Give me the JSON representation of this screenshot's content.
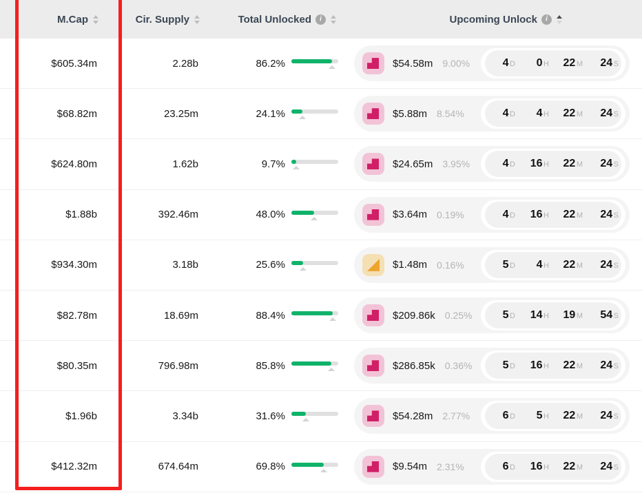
{
  "header": {
    "columns": [
      {
        "label": "M.Cap",
        "has_info": false,
        "sort": "none"
      },
      {
        "label": "Cir. Supply",
        "has_info": false,
        "sort": "none"
      },
      {
        "label": "Total Unlocked",
        "has_info": true,
        "sort": "none"
      },
      {
        "label": "Upcoming Unlock",
        "has_info": true,
        "sort": "asc"
      }
    ]
  },
  "rows": [
    {
      "mcap": "$605.34m",
      "supply": "2.28b",
      "unlocked_pct_label": "86.2%",
      "unlocked_pct": 86.2,
      "unlock_amount": "$54.58m",
      "unlock_pct": "9.00%",
      "icon": "token-step-pink-icon",
      "icon_variant": "pink",
      "cd_d": "4",
      "cd_h": "0",
      "cd_m": "22",
      "cd_s": "24"
    },
    {
      "mcap": "$68.82m",
      "supply": "23.25m",
      "unlocked_pct_label": "24.1%",
      "unlocked_pct": 24.1,
      "unlock_amount": "$5.88m",
      "unlock_pct": "8.54%",
      "icon": "token-step-pink-icon",
      "icon_variant": "pink",
      "cd_d": "4",
      "cd_h": "4",
      "cd_m": "22",
      "cd_s": "24"
    },
    {
      "mcap": "$624.80m",
      "supply": "1.62b",
      "unlocked_pct_label": "9.7%",
      "unlocked_pct": 9.7,
      "unlock_amount": "$24.65m",
      "unlock_pct": "3.95%",
      "icon": "token-step-pink-icon",
      "icon_variant": "pink",
      "cd_d": "4",
      "cd_h": "16",
      "cd_m": "22",
      "cd_s": "24"
    },
    {
      "mcap": "$1.88b",
      "supply": "392.46m",
      "unlocked_pct_label": "48.0%",
      "unlocked_pct": 48.0,
      "unlock_amount": "$3.64m",
      "unlock_pct": "0.19%",
      "icon": "token-step-pink-icon",
      "icon_variant": "pink",
      "cd_d": "4",
      "cd_h": "16",
      "cd_m": "22",
      "cd_s": "24"
    },
    {
      "mcap": "$934.30m",
      "supply": "3.18b",
      "unlocked_pct_label": "25.6%",
      "unlocked_pct": 25.6,
      "unlock_amount": "$1.48m",
      "unlock_pct": "0.16%",
      "icon": "token-triangle-yellow-icon",
      "icon_variant": "yellow",
      "cd_d": "5",
      "cd_h": "4",
      "cd_m": "22",
      "cd_s": "24"
    },
    {
      "mcap": "$82.78m",
      "supply": "18.69m",
      "unlocked_pct_label": "88.4%",
      "unlocked_pct": 88.4,
      "unlock_amount": "$209.86k",
      "unlock_pct": "0.25%",
      "icon": "token-step-pink-icon",
      "icon_variant": "pink",
      "cd_d": "5",
      "cd_h": "14",
      "cd_m": "19",
      "cd_s": "54"
    },
    {
      "mcap": "$80.35m",
      "supply": "796.98m",
      "unlocked_pct_label": "85.8%",
      "unlocked_pct": 85.8,
      "unlock_amount": "$286.85k",
      "unlock_pct": "0.36%",
      "icon": "token-step-pink-icon",
      "icon_variant": "pink",
      "cd_d": "5",
      "cd_h": "16",
      "cd_m": "22",
      "cd_s": "24"
    },
    {
      "mcap": "$1.96b",
      "supply": "3.34b",
      "unlocked_pct_label": "31.6%",
      "unlocked_pct": 31.6,
      "unlock_amount": "$54.28m",
      "unlock_pct": "2.77%",
      "icon": "token-step-pink-icon",
      "icon_variant": "pink",
      "cd_d": "6",
      "cd_h": "5",
      "cd_m": "22",
      "cd_s": "24"
    },
    {
      "mcap": "$412.32m",
      "supply": "674.64m",
      "unlocked_pct_label": "69.8%",
      "unlocked_pct": 69.8,
      "unlock_amount": "$9.54m",
      "unlock_pct": "2.31%",
      "icon": "token-step-pink-icon",
      "icon_variant": "pink",
      "cd_d": "6",
      "cd_h": "16",
      "cd_m": "22",
      "cd_s": "24"
    }
  ],
  "units": {
    "d": "D",
    "h": "H",
    "m": "M",
    "s": "S"
  },
  "info_glyph": "i",
  "colors": {
    "header_bg": "#ececec",
    "progress_fill": "#0fb36a",
    "progress_track": "#e0e0e0",
    "token_pink_bg": "#f2c3d6",
    "token_pink_fg": "#d01f66",
    "token_yellow_bg": "#f5e0b4",
    "token_yellow_fg": "#eda52f",
    "highlight": "#f41f1f",
    "muted_text": "#b4b4b4"
  }
}
